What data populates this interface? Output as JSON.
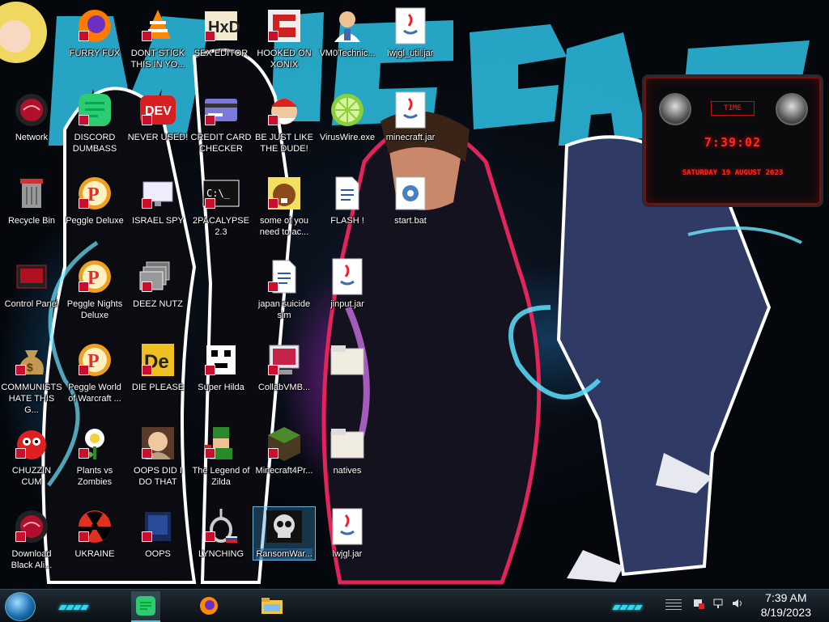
{
  "desktop": {
    "icons": [
      {
        "id": "furry-fux",
        "label": "FURRY FUX",
        "kind": "firefox"
      },
      {
        "id": "dont-stick",
        "label": "DONT STICK THIS IN YO...",
        "kind": "vlc"
      },
      {
        "id": "sex-editor",
        "label": "SEX EDITOR",
        "kind": "hxd"
      },
      {
        "id": "hooked-on-xonix",
        "label": "HOOKED ON XONIX",
        "kind": "maze"
      },
      {
        "id": "vm0",
        "label": "VM0Technic...",
        "kind": "doctor"
      },
      {
        "id": "lwjgl-util",
        "label": "lwjgl_util.jar",
        "kind": "java"
      },
      {
        "id": "network",
        "label": "Network",
        "kind": "redorb"
      },
      {
        "id": "discord-dumbass",
        "label": "DISCORD DUMBASS",
        "kind": "greenchat"
      },
      {
        "id": "never-used",
        "label": "NEVER USED!",
        "kind": "dev"
      },
      {
        "id": "credit-card",
        "label": "CREDIT CARD CHECKER",
        "kind": "card"
      },
      {
        "id": "be-just-like",
        "label": "BE JUST LIKE THE DUDE!",
        "kind": "santa"
      },
      {
        "id": "virus-wire",
        "label": "VirusWire.exe",
        "kind": "lime"
      },
      {
        "id": "minecraft-jar",
        "label": "minecraft.jar",
        "kind": "java"
      },
      {
        "id": "recycle-bin",
        "label": "Recycle Bin",
        "kind": "bin"
      },
      {
        "id": "peggle-deluxe",
        "label": "Peggle Deluxe",
        "kind": "peggle"
      },
      {
        "id": "israel-spy",
        "label": "ISRAEL SPY",
        "kind": "monitor"
      },
      {
        "id": "2pacalypse",
        "label": "2PACALYPSE 2.3",
        "kind": "terminal"
      },
      {
        "id": "some-of-you",
        "label": "some of you need to ac...",
        "kind": "beaver"
      },
      {
        "id": "flash",
        "label": "FLASH !",
        "kind": "doc"
      },
      {
        "id": "start-bat",
        "label": "start.bat",
        "kind": "gear"
      },
      {
        "id": "control-panel",
        "label": "Control Panel",
        "kind": "cpanel"
      },
      {
        "id": "peggle-nights",
        "label": "Peggle Nights Deluxe",
        "kind": "peggle"
      },
      {
        "id": "deez-nutz",
        "label": "DEEZ NUTZ",
        "kind": "windows"
      },
      {
        "id": "japan-suicide",
        "label": "japan suicide sim",
        "kind": "doc"
      },
      {
        "id": "jinput-jar",
        "label": "jinput.jar",
        "kind": "java"
      },
      {
        "id": "communists",
        "label": "COMMUNISTS HATE THIS G...",
        "kind": "moneybag"
      },
      {
        "id": "peggle-wow",
        "label": "Peggle World of Warcraft ...",
        "kind": "peggle"
      },
      {
        "id": "die-please",
        "label": "DIE PLEASE",
        "kind": "de"
      },
      {
        "id": "super-hilda",
        "label": "Super Hilda",
        "kind": "pixel"
      },
      {
        "id": "collabvmb",
        "label": "CollabVMB...",
        "kind": "redmonitor"
      },
      {
        "id": "folder-d",
        "label": "",
        "kind": "folder"
      },
      {
        "id": "chuzzin",
        "label": "CHUZZIN CUM",
        "kind": "chuzzle"
      },
      {
        "id": "plants-vs-zombies",
        "label": "Plants vs Zombies",
        "kind": "flower"
      },
      {
        "id": "oops-did",
        "label": "OOPS DID I DO THAT",
        "kind": "portrait"
      },
      {
        "id": "legend-zilda",
        "label": "The Legend of Zilda",
        "kind": "link"
      },
      {
        "id": "minecraft4pr",
        "label": "Minecraft4Pr...",
        "kind": "block"
      },
      {
        "id": "natives",
        "label": "natives",
        "kind": "folder"
      },
      {
        "id": "download-black",
        "label": "Download Black Ali...",
        "kind": "redorb"
      },
      {
        "id": "ukraine",
        "label": "UKRAINE",
        "kind": "radiation"
      },
      {
        "id": "oops",
        "label": "OOPS",
        "kind": "bluebook"
      },
      {
        "id": "lynching",
        "label": "LYNCHING",
        "kind": "noose"
      },
      {
        "id": "ransomware",
        "label": "RansomWar...",
        "kind": "skull",
        "selected": true
      },
      {
        "id": "lwjgl-jar",
        "label": "lwjgl.jar",
        "kind": "java"
      }
    ]
  },
  "widget": {
    "time_badge": "TIME",
    "time": "7:39:02",
    "date": "SATURDAY 19 AUGUST 2023"
  },
  "taskbar": {
    "start_label": "Start",
    "apps": [
      {
        "id": "discord",
        "kind": "greenchat",
        "active": true
      },
      {
        "id": "firefox",
        "kind": "firefox"
      },
      {
        "id": "explorer",
        "kind": "folder"
      }
    ],
    "clock_time": "7:39 AM",
    "clock_date": "8/19/2023"
  },
  "colors": {
    "accent": "#2fd7f0",
    "widget_red": "#ff2a1a",
    "taskbar": "#121b22"
  }
}
